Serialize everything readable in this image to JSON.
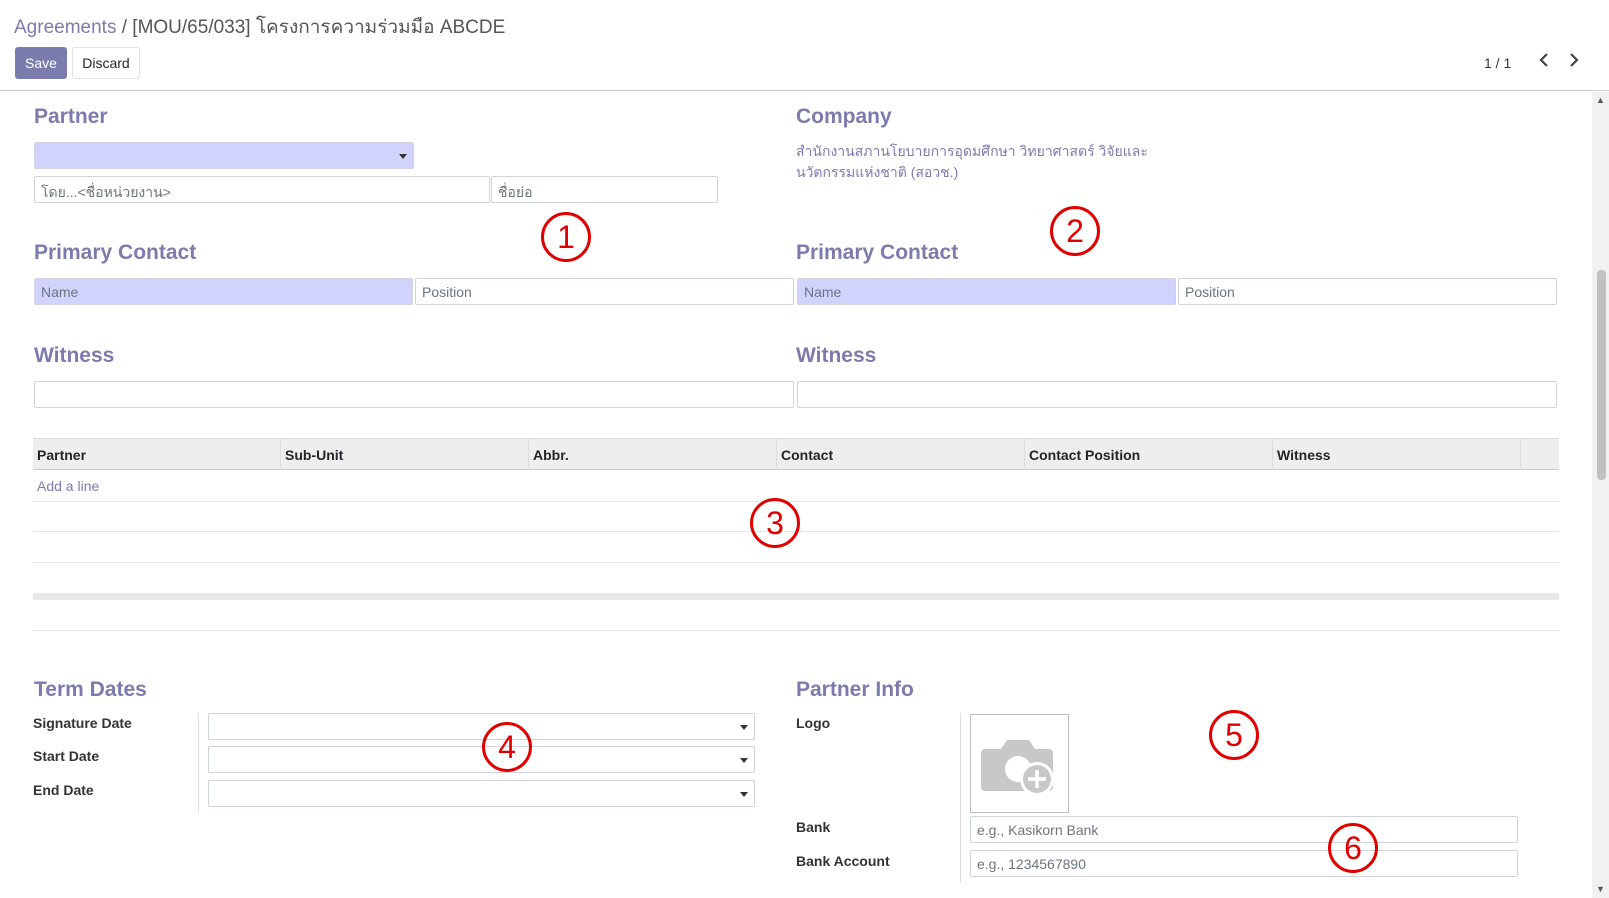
{
  "breadcrumb": {
    "parent": "Agreements",
    "separator": "/",
    "current": "[MOU/65/033] โครงการความร่วมมือ ABCDE"
  },
  "toolbar": {
    "save_label": "Save",
    "discard_label": "Discard"
  },
  "pager": {
    "text": "1 / 1",
    "prev_icon": "chevron-left-icon",
    "next_icon": "chevron-right-icon"
  },
  "partner_section": {
    "title": "Partner",
    "unit_placeholder": "โดย...<ชื่อหน่วยงาน>",
    "abbr_placeholder": "ชื่อย่อ"
  },
  "company_section": {
    "title": "Company",
    "company_name_line1": "สำนักงานสภานโยบายการอุดมศึกษา วิทยาศาสตร์ วิจัยและ",
    "company_name_line2": "นวัตกรรมแห่งชาติ (สอวช.)"
  },
  "partner_contact": {
    "title": "Primary Contact",
    "name_placeholder": "Name",
    "position_placeholder": "Position"
  },
  "company_contact": {
    "title": "Primary Contact",
    "name_placeholder": "Name",
    "position_placeholder": "Position"
  },
  "partner_witness": {
    "title": "Witness"
  },
  "company_witness": {
    "title": "Witness"
  },
  "lines_table": {
    "columns": [
      "Partner",
      "Sub-Unit",
      "Abbr.",
      "Contact",
      "Contact Position",
      "Witness"
    ],
    "add_line": "Add a line"
  },
  "term_dates": {
    "title": "Term Dates",
    "signature_label": "Signature Date",
    "start_label": "Start Date",
    "end_label": "End Date"
  },
  "partner_info": {
    "title": "Partner Info",
    "logo_label": "Logo",
    "logo_icon": "camera-add-icon",
    "bank_label": "Bank",
    "bank_placeholder": "e.g., Kasikorn Bank",
    "account_label": "Bank Account",
    "account_placeholder": "e.g., 1234567890"
  },
  "annotations": [
    "1",
    "2",
    "3",
    "4",
    "5",
    "6"
  ],
  "colors": {
    "accent": "#7c7bad",
    "required_bg": "#d2d2ff",
    "annotation": "#e00000"
  }
}
